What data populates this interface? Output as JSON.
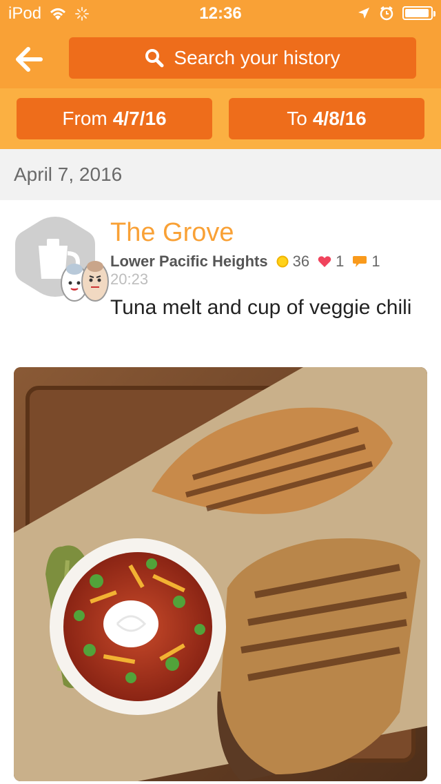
{
  "status_bar": {
    "device": "iPod",
    "time": "12:36"
  },
  "header": {
    "back_icon": "arrow-left-icon",
    "search_placeholder": "Search your history"
  },
  "filters": {
    "from_label": "From",
    "from_value": "4/7/16",
    "to_label": "To",
    "to_value": "4/8/16"
  },
  "date_header": "April 7, 2016",
  "checkin": {
    "venue": "The Grove",
    "neighborhood": "Lower Pacific Heights",
    "coins": "36",
    "likes": "1",
    "comments": "1",
    "time": "20:23",
    "shout": "Tuna melt and cup of veggie chili"
  },
  "colors": {
    "nav_orange": "#f9a136",
    "button_orange": "#ee6d1b",
    "filter_bar": "#fbb042"
  }
}
